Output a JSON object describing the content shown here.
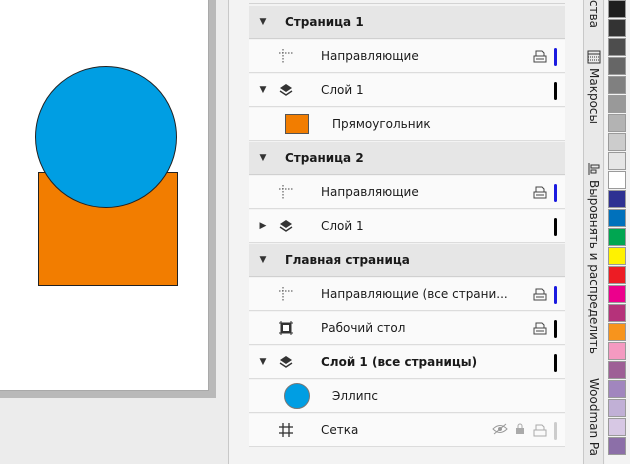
{
  "canvas": {
    "shapes": {
      "rectangle_color": "#f27d00",
      "ellipse_color": "#009ee3"
    }
  },
  "object_manager": {
    "rows": [
      {
        "type": "page",
        "label": "Страница 1",
        "expanded": true
      },
      {
        "type": "guides",
        "label": "Направляющие",
        "bar_color": "#1a1adf"
      },
      {
        "type": "layer",
        "label": "Слой 1",
        "expanded": true,
        "bar_color": "#000000"
      },
      {
        "type": "object",
        "label": "Прямоугольник",
        "swatch": "#f27d00"
      },
      {
        "type": "page",
        "label": "Страница 2",
        "expanded": true
      },
      {
        "type": "guides",
        "label": "Направляющие",
        "bar_color": "#1a1adf"
      },
      {
        "type": "layer",
        "label": "Слой 1",
        "expanded": false,
        "bar_color": "#000000"
      },
      {
        "type": "page",
        "label": "Главная страница",
        "expanded": true
      },
      {
        "type": "guides",
        "label": "Направляющие (все страни...",
        "bar_color": "#1a1adf"
      },
      {
        "type": "desktop",
        "label": "Рабочий стол",
        "bar_color": "#000000"
      },
      {
        "type": "layer",
        "label": "Слой 1 (все страницы)",
        "expanded": true,
        "bold": true,
        "bar_color": "#000000"
      },
      {
        "type": "object",
        "label": "Эллипс",
        "swatch": "#009ee3"
      },
      {
        "type": "grid",
        "label": "Сетка",
        "bar_color": "#cccccc"
      }
    ]
  },
  "docker_tabs": {
    "properties": "ства",
    "macros": "Макросы",
    "align": "Выровнять и распределить",
    "woodman": "Woodman Pa"
  },
  "palette": {
    "colors": [
      "#1e1e1e",
      "#333333",
      "#4d4d4d",
      "#666666",
      "#808080",
      "#999999",
      "#b3b3b3",
      "#cccccc",
      "#e6e6e6",
      "#ffffff",
      "#2e3192",
      "#0071bc",
      "#00a651",
      "#fff200",
      "#ed1c24",
      "#ec008c",
      "#b5327a",
      "#f7941d",
      "#f49ac1",
      "#9e6096",
      "#a186be",
      "#c1b0d6",
      "#d7c8e4",
      "#8c6fa8"
    ]
  }
}
